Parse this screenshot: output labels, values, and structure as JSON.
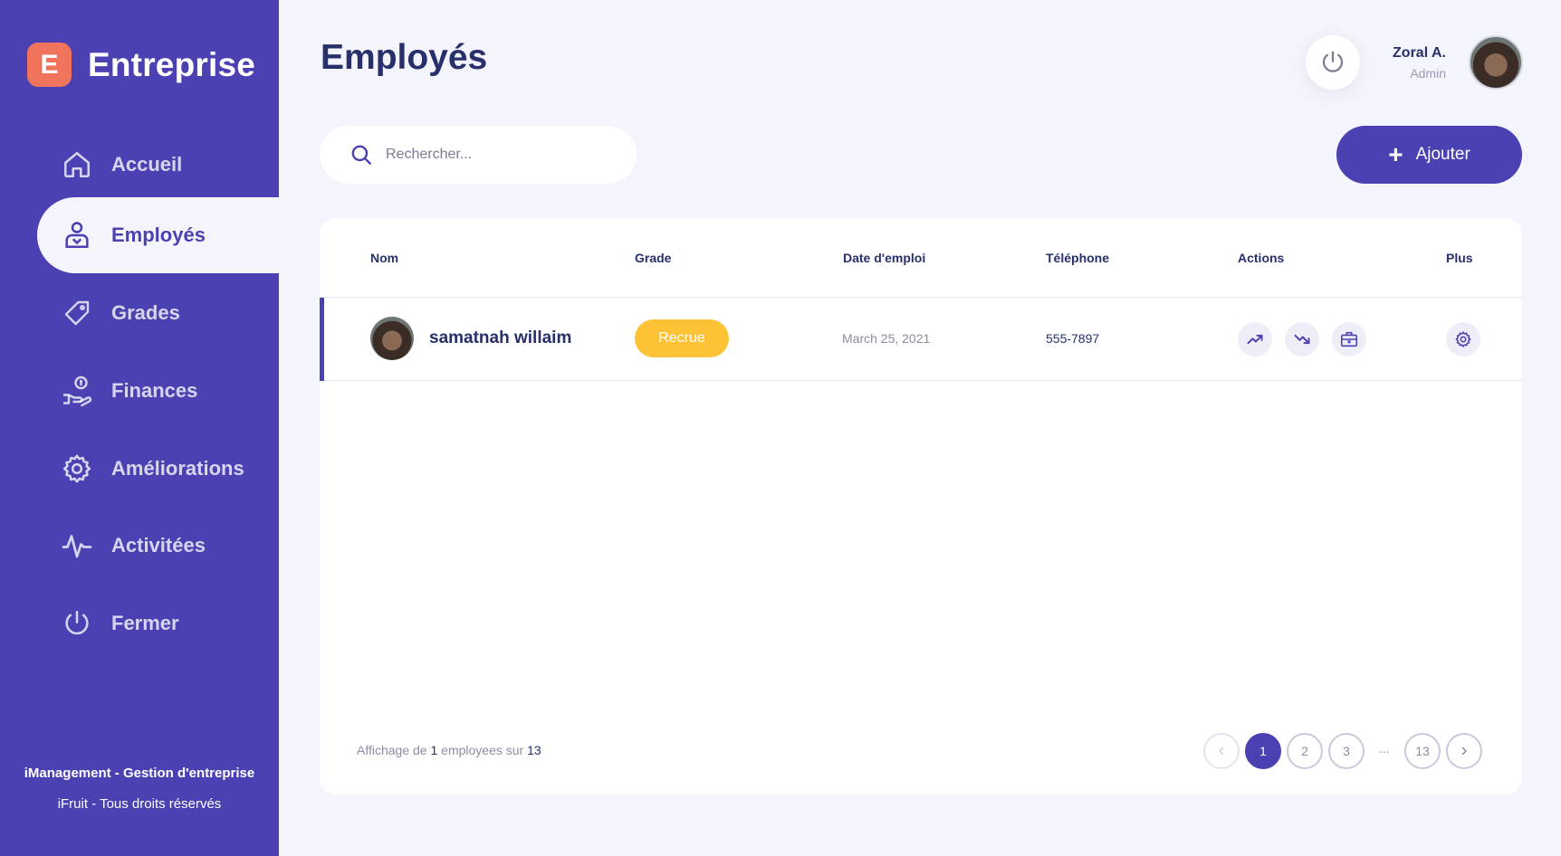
{
  "brand": {
    "logo_letter": "E",
    "name": "Entreprise"
  },
  "nav": [
    {
      "label": "Accueil",
      "icon": "home-icon",
      "active": false
    },
    {
      "label": "Employés",
      "icon": "employee-icon",
      "active": true
    },
    {
      "label": "Grades",
      "icon": "tag-icon",
      "active": false
    },
    {
      "label": "Finances",
      "icon": "money-hand-icon",
      "active": false
    },
    {
      "label": "Améliorations",
      "icon": "gear-icon",
      "active": false
    },
    {
      "label": "Activitées",
      "icon": "activity-icon",
      "active": false
    },
    {
      "label": "Fermer",
      "icon": "power-icon",
      "active": false
    }
  ],
  "sidebar_footer": {
    "line1": "iManagement - Gestion d'entreprise",
    "line2": "iFruit - Tous droits réservés"
  },
  "header": {
    "title": "Employés",
    "user_name": "Zoral A.",
    "user_role": "Admin"
  },
  "search": {
    "placeholder": "Rechercher..."
  },
  "add_button": {
    "label": "Ajouter"
  },
  "table": {
    "columns": [
      "Nom",
      "Grade",
      "Date d'emploi",
      "Téléphone",
      "Actions",
      "Plus"
    ],
    "rows": [
      {
        "name": "samatnah willaim",
        "grade": "Recrue",
        "date": "March 25, 2021",
        "phone": "555-7897"
      }
    ]
  },
  "pagination": {
    "info_prefix": "Affichage de ",
    "shown": "1",
    "info_middle": " employees sur ",
    "total": "13",
    "pages": [
      "1",
      "2",
      "3",
      "...",
      "13"
    ],
    "current": "1"
  },
  "colors": {
    "sidebar": "#4b41b2",
    "accent": "#4b41b2",
    "badge": "#fdc235",
    "logo": "#f0735c",
    "background": "#f4f4fc"
  }
}
